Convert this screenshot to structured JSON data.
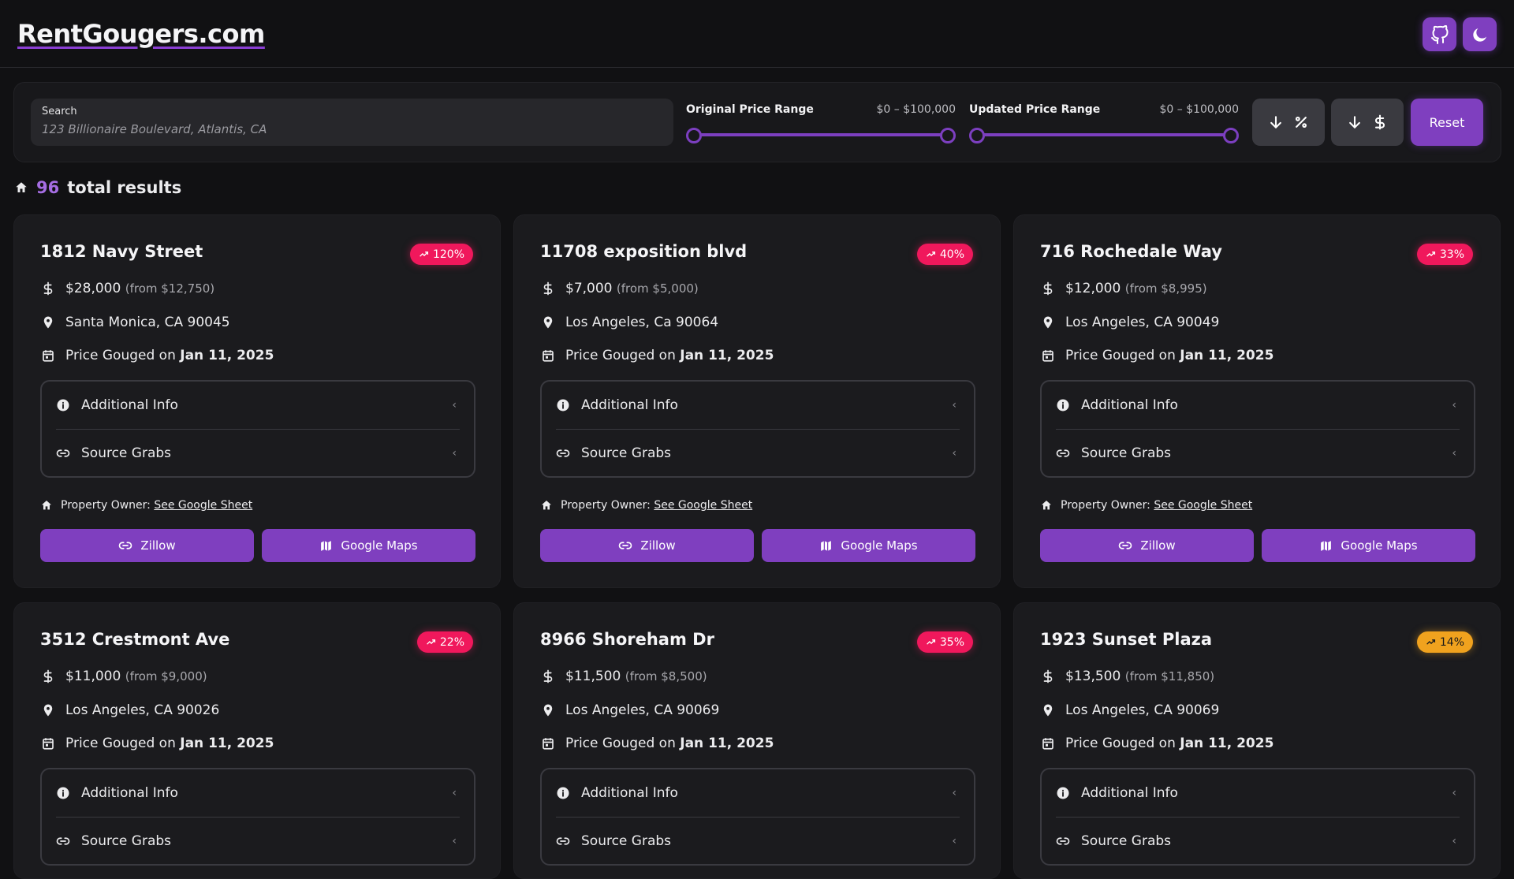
{
  "header": {
    "logo": "RentGougers.com",
    "buttons": [
      "github-icon",
      "moon-icon"
    ]
  },
  "filters": {
    "search": {
      "label": "Search",
      "placeholder": "123 Billionaire Boulevard, Atlantis, CA"
    },
    "original_range": {
      "label": "Original Price Range",
      "value": "$0 – $100,000"
    },
    "updated_range": {
      "label": "Updated Price Range",
      "value": "$0 – $100,000"
    },
    "sort_percent": {
      "icons": [
        "arrow-down-icon",
        "percent-icon"
      ]
    },
    "sort_price": {
      "icons": [
        "arrow-down-icon",
        "dollar-icon"
      ]
    },
    "reset_label": "Reset"
  },
  "results": {
    "count": "96",
    "label": "total results"
  },
  "cards": [
    {
      "title": "1812 Navy Street",
      "badge": "120%",
      "badge_color": "pink",
      "price": "$28,000",
      "from": "(from $12,750)",
      "location": "Santa Monica, CA 90045",
      "gouged_prefix": "Price Gouged on",
      "gouged_date": "Jan 11, 2025",
      "additional_info": "Additional Info",
      "source_grabs": "Source Grabs",
      "owner_label": "Property Owner:",
      "owner_link": "See Google Sheet",
      "zillow": "Zillow",
      "maps": "Google Maps"
    },
    {
      "title": "11708 exposition blvd",
      "badge": "40%",
      "badge_color": "pink",
      "price": "$7,000",
      "from": "(from $5,000)",
      "location": "Los Angeles, Ca 90064",
      "gouged_prefix": "Price Gouged on",
      "gouged_date": "Jan 11, 2025",
      "additional_info": "Additional Info",
      "source_grabs": "Source Grabs",
      "owner_label": "Property Owner:",
      "owner_link": "See Google Sheet",
      "zillow": "Zillow",
      "maps": "Google Maps"
    },
    {
      "title": "716 Rochedale Way",
      "badge": "33%",
      "badge_color": "pink",
      "price": "$12,000",
      "from": "(from $8,995)",
      "location": "Los Angeles, CA 90049",
      "gouged_prefix": "Price Gouged on",
      "gouged_date": "Jan 11, 2025",
      "additional_info": "Additional Info",
      "source_grabs": "Source Grabs",
      "owner_label": "Property Owner:",
      "owner_link": "See Google Sheet",
      "zillow": "Zillow",
      "maps": "Google Maps"
    },
    {
      "title": "3512 Crestmont Ave",
      "badge": "22%",
      "badge_color": "pink",
      "price": "$11,000",
      "from": "(from $9,000)",
      "location": "Los Angeles, CA 90026",
      "gouged_prefix": "Price Gouged on",
      "gouged_date": "Jan 11, 2025",
      "additional_info": "Additional Info",
      "source_grabs": "Source Grabs"
    },
    {
      "title": "8966 Shoreham Dr",
      "badge": "35%",
      "badge_color": "pink",
      "price": "$11,500",
      "from": "(from $8,500)",
      "location": "Los Angeles, CA 90069",
      "gouged_prefix": "Price Gouged on",
      "gouged_date": "Jan 11, 2025",
      "additional_info": "Additional Info",
      "source_grabs": "Source Grabs"
    },
    {
      "title": "1923 Sunset Plaza",
      "badge": "14%",
      "badge_color": "orange",
      "price": "$13,500",
      "from": "(from $11,850)",
      "location": "Los Angeles, CA 90069",
      "gouged_prefix": "Price Gouged on",
      "gouged_date": "Jan 11, 2025",
      "additional_info": "Additional Info",
      "source_grabs": "Source Grabs"
    }
  ]
}
